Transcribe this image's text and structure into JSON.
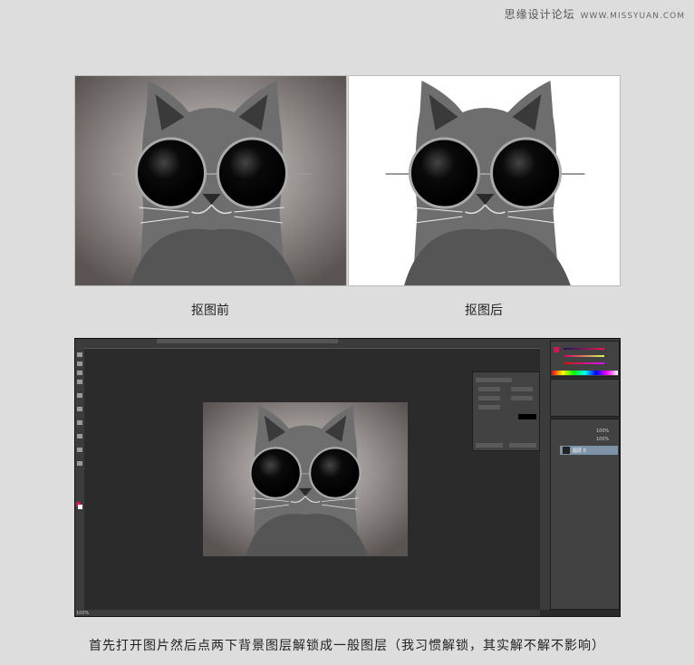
{
  "watermark": {
    "site_name": "思缘设计论坛",
    "url": "WWW.MISSYUAN.COM"
  },
  "before_label": "抠图前",
  "after_label": "抠图后",
  "caption": "首先打开图片然后点两下背景图层解锁成一般图层（我习惯解锁，其实解不解不影响）",
  "photoshop": {
    "zoom": "100%",
    "layer_name": "图层 0",
    "opacity": "100%",
    "fill": "100%",
    "colors": {
      "background": "#2b2b2b",
      "panel": "#424242",
      "foreground_swatch": "#d4145a",
      "layer_selected": "#7f93a8"
    }
  }
}
